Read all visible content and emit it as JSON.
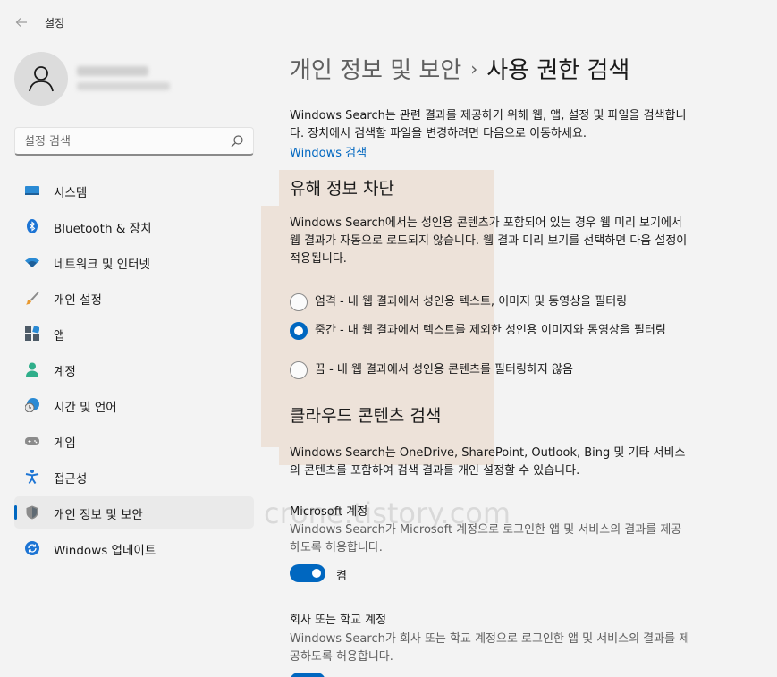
{
  "window": {
    "title": "설정",
    "back_icon": "back-arrow-icon"
  },
  "sidebar": {
    "search_placeholder": "설정 검색",
    "items": [
      {
        "label": "시스템",
        "icon": "display-icon"
      },
      {
        "label": "Bluetooth & 장치",
        "icon": "bluetooth-icon"
      },
      {
        "label": "네트워크 및 인터넷",
        "icon": "wifi-icon"
      },
      {
        "label": "개인 설정",
        "icon": "brush-icon"
      },
      {
        "label": "앱",
        "icon": "apps-icon"
      },
      {
        "label": "계정",
        "icon": "person-icon"
      },
      {
        "label": "시간 및 언어",
        "icon": "clock-globe-icon"
      },
      {
        "label": "게임",
        "icon": "gamepad-icon"
      },
      {
        "label": "접근성",
        "icon": "accessibility-icon"
      },
      {
        "label": "개인 정보 및 보안",
        "icon": "shield-icon",
        "active": true
      },
      {
        "label": "Windows 업데이트",
        "icon": "update-icon"
      }
    ]
  },
  "main": {
    "breadcrumb": {
      "parent": "개인 정보 및 보안",
      "separator": "›",
      "current": "사용 권한 검색"
    },
    "intro_text": "Windows Search는 관련 결과를 제공하기 위해 웹, 앱, 설정 및 파일을 검색합니다. 장치에서 검색할 파일을 변경하려면 다음으로 이동하세요.",
    "intro_link": "Windows 검색",
    "safe_search": {
      "heading": "유해 정보 차단",
      "description": "Windows Search에서는 성인용 콘텐츠가 포함되어 있는 경우 웹 미리 보기에서 웹 결과가 자동으로 로드되지 않습니다. 웹 결과 미리 보기를 선택하면 다음 설정이 적용됩니다.",
      "options": [
        {
          "label": "엄격 - 내 웹 결과에서 성인용 텍스트, 이미지 및 동영상을 필터링",
          "checked": false
        },
        {
          "label": "중간 - 내 웹 결과에서 텍스트를 제외한 성인용 이미지와 동영상을 필터링",
          "checked": true
        },
        {
          "label": "끔 - 내 웹 결과에서 성인용 콘텐츠를 필터링하지 않음",
          "checked": false
        }
      ]
    },
    "cloud_search": {
      "heading": "클라우드 콘텐츠 검색",
      "description": "Windows Search는 OneDrive, SharePoint, Outlook, Bing 및 기타 서비스의 콘텐츠를 포함하여 검색 결과를 개인 설정할 수 있습니다.",
      "microsoft_account": {
        "title": "Microsoft 계정",
        "description": "Windows Search가 Microsoft 계정으로 로그인한 앱 및 서비스의 결과를 제공하도록 허용합니다.",
        "toggle_label": "켬",
        "toggle_on": true
      },
      "work_account": {
        "title": "회사 또는 학교 계정",
        "description": "Windows Search가 회사 또는 학교 계정으로 로그인한 앱 및 서비스의 결과를 제공하도록 허용합니다.",
        "toggle_on": true
      }
    }
  },
  "watermark": "crone.tistory.com",
  "colors": {
    "accent": "#0067c0",
    "background": "#f3f3f3"
  }
}
